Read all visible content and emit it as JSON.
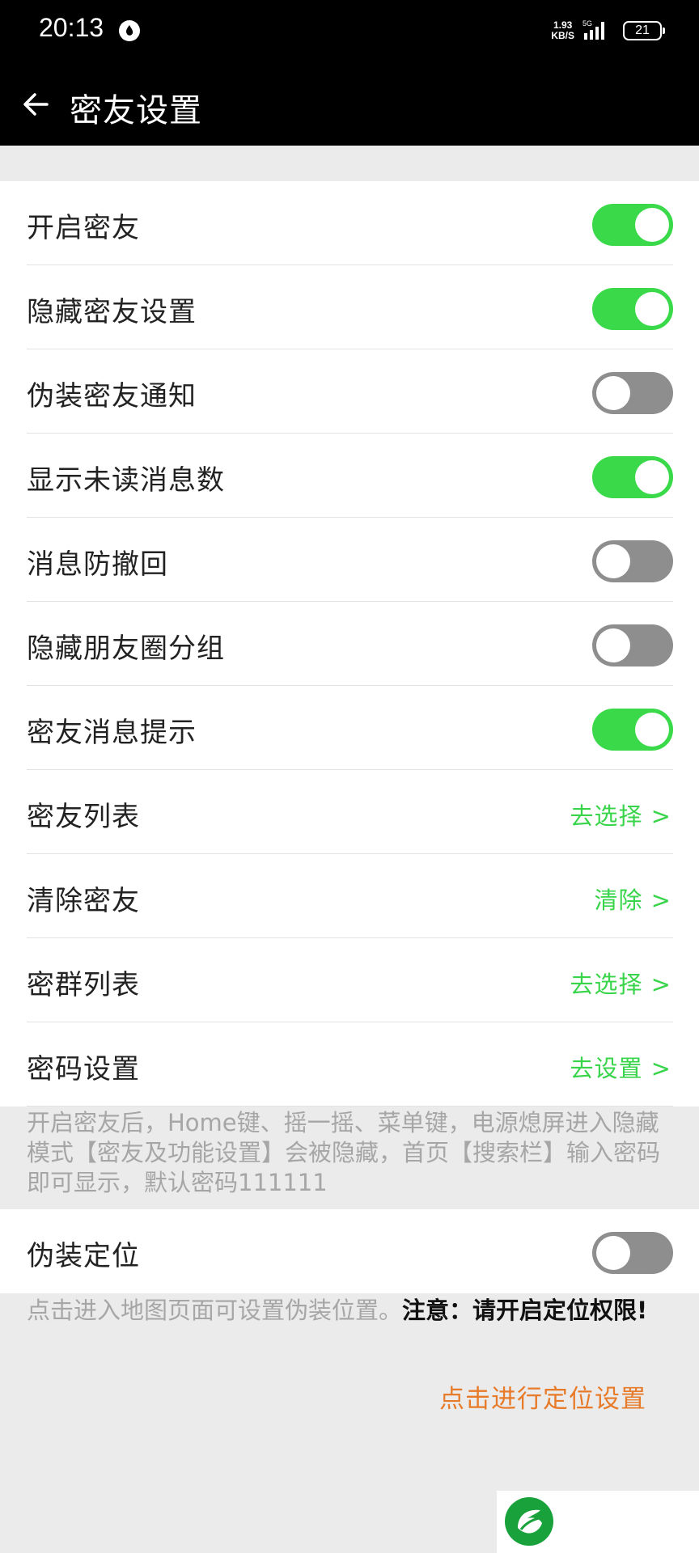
{
  "status_bar": {
    "time": "20:13",
    "speed_top": "1.93",
    "speed_bottom": "KB/S",
    "network": "5G",
    "battery": "21"
  },
  "header": {
    "title": "密友设置"
  },
  "settings": [
    {
      "label": "开启密友",
      "type": "toggle",
      "on": true
    },
    {
      "label": "隐藏密友设置",
      "type": "toggle",
      "on": true
    },
    {
      "label": "伪装密友通知",
      "type": "toggle",
      "on": false
    },
    {
      "label": "显示未读消息数",
      "type": "toggle",
      "on": true
    },
    {
      "label": "消息防撤回",
      "type": "toggle",
      "on": false
    },
    {
      "label": "隐藏朋友圈分组",
      "type": "toggle",
      "on": false
    },
    {
      "label": "密友消息提示",
      "type": "toggle",
      "on": true
    },
    {
      "label": "密友列表",
      "type": "action",
      "action": "去选择 >"
    },
    {
      "label": "清除密友",
      "type": "action",
      "action": "清除 >"
    },
    {
      "label": "密群列表",
      "type": "action",
      "action": "去选择 >"
    },
    {
      "label": "密码设置",
      "type": "action",
      "action": "去设置 >"
    }
  ],
  "hidden_mode_note": "开启密友后，Home键、摇一摇、菜单键，电源熄屏进入隐藏模式【密友及功能设置】会被隐藏，首页【搜索栏】输入密码即可显示，默认密码111111",
  "location": {
    "label": "伪装定位",
    "on": false,
    "note_plain": "点击进入地图页面可设置伪装位置。",
    "note_bold": "注意：请开启定位权限!",
    "link": "点击进行定位设置"
  },
  "colors": {
    "accent_green": "#3ad94a",
    "toggle_off": "#8e8e8e",
    "link_orange": "#e77b2a"
  }
}
